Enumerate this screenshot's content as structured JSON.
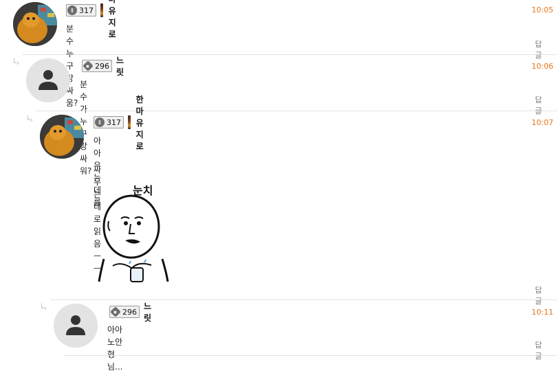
{
  "comments": [
    {
      "level": "317",
      "nickname": "한마유지로",
      "time": "10:05",
      "text": "분수 누구랑싸움?",
      "reply_label": "답글"
    },
    {
      "level": "296",
      "nickname": "느릿",
      "time": "10:06",
      "text": "분수가 누구랑싸워?",
      "reply_label": "답글"
    },
    {
      "level": "317",
      "nickname": "한마유지로",
      "time": "10:07",
      "text_line1": "아아 우는데를",
      "text_line2": "싸우는데로 읽음ㅡㅡ",
      "sticker_caption": "눈치",
      "reply_label": "답글"
    },
    {
      "level": "296",
      "nickname": "느릿",
      "time": "10:11",
      "text": "아아 노안 형님...",
      "reply_label": "답글"
    }
  ],
  "icons": {
    "reply_indent": "reply-arrow-icon",
    "default_avatar": "user-silhouette-icon"
  },
  "colors": {
    "timestamp": "#e8751a",
    "divider": "#e2e2e2"
  }
}
